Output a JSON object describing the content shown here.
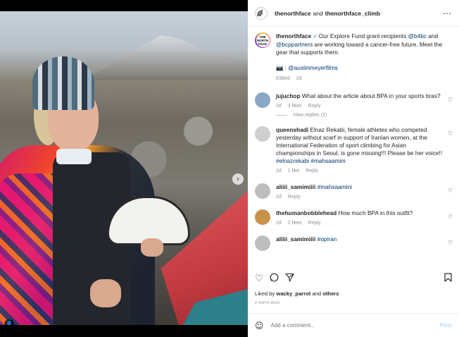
{
  "header": {
    "account1": "thenorthface",
    "and": "and",
    "account2": "thenorthface_climb",
    "more_icon": "⋯"
  },
  "photo": {
    "next_icon": "›",
    "user_tag_icon": "👤",
    "slides": 2,
    "active_slide": 0
  },
  "caption": {
    "username": "thenorthface",
    "verified_icon": "✔",
    "text1": "Our Explore Fund grant recipients ",
    "mention1": "@b4bc",
    "text2": " and ",
    "mention2": "@bcppartners",
    "text3": " are working toward a cancer-free future. Meet the gear that supports them.",
    "camera": "📷 : ",
    "mention3": "@austinmeyerfilms",
    "edited": "Edited",
    "time": "2d"
  },
  "comments": [
    {
      "username": "jujuchop",
      "text": "What about the article about BPA in your sports bras?",
      "time": "2d",
      "likes": "3 likes",
      "reply": "Reply",
      "view_replies": "View replies (2)",
      "avatar_color": "#8aa7c4"
    },
    {
      "username": "queenshadi",
      "text": "Elnaz Rekabi, female athletes who competed yesterday without scarf in support of Iranian women, at the International Federation of sport climbing for Asian championships in Seoul, is gone missing!!! Please be her voice!!",
      "tags": "#elnazrekabi #mahsaamini",
      "time": "2d",
      "likes": "1 like",
      "reply": "Reply",
      "avatar_color": "#cfcfcf"
    },
    {
      "username": "aliiii_samimiiii",
      "tag": "#mahsaamini",
      "time": "2d",
      "reply": "Reply",
      "avatar_color": "#bdbdbd"
    },
    {
      "username": "thehumanbobblehead",
      "text": "How much BPA in this outfit?",
      "time": "2d",
      "likes": "2 likes",
      "reply": "Reply",
      "avatar_color": "#c8924d"
    },
    {
      "username": "aliiii_samimiiii",
      "tag": "#opiran",
      "avatar_color": "#bdbdbd"
    }
  ],
  "actions": {
    "like_icon": "♡",
    "comment_icon": "◯",
    "share_icon": "➤",
    "save_icon": "🔖",
    "heart_icon": "♡"
  },
  "likes": {
    "prefix": "Liked by ",
    "user": "wacky_parrot",
    "and": " and ",
    "others": "others"
  },
  "date": "2 DAYS AGO",
  "add_comment": {
    "emoji_icon": "☺",
    "placeholder": "Add a comment...",
    "post": "Post"
  },
  "logo_text": "THE NORTH FACE"
}
